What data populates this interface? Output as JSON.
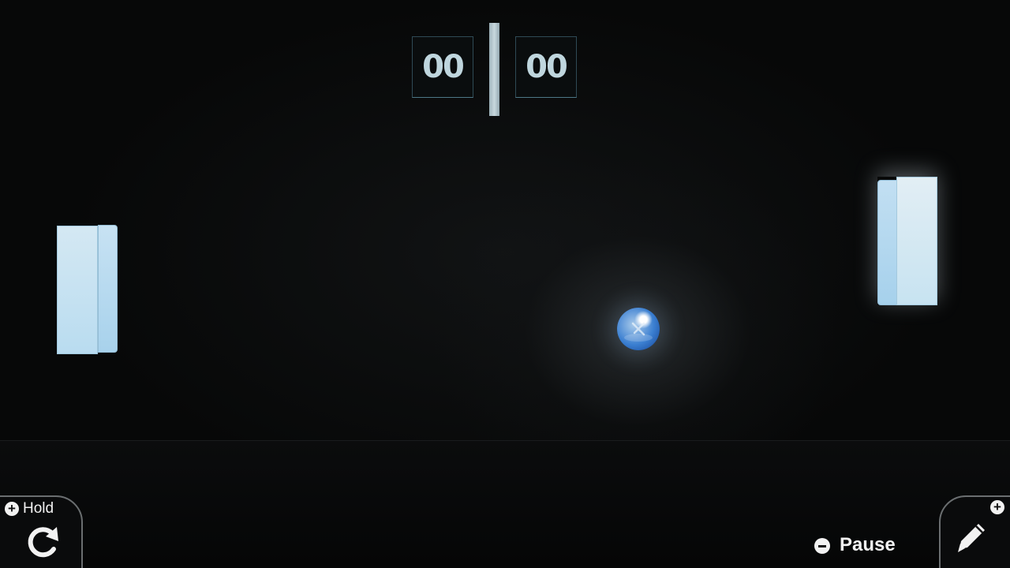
{
  "scoreboard": {
    "left_score": "00",
    "right_score": "00"
  },
  "hud": {
    "hold_label": "Hold",
    "hold_button_icon": "rotate-icon",
    "edit_button_icon": "pencil-icon",
    "pause_label": "Pause",
    "pause_button_icon": "minus-icon",
    "plus_badge_icon": "plus-icon"
  },
  "colors": {
    "background": "#070808",
    "paddle": "#c9e4f2",
    "ball": "#3b7fd1",
    "score_text": "#bfd6de"
  }
}
